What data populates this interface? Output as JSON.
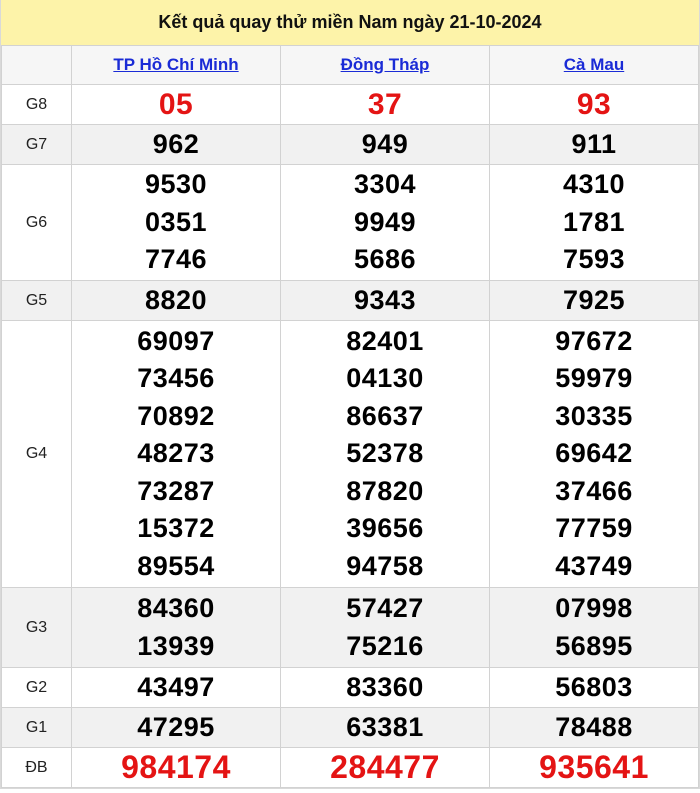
{
  "title": "Kết quả quay thử miền Nam ngày 21-10-2024",
  "provinces": [
    "TP Hồ Chí Minh",
    "Đồng Tháp",
    "Cà Mau"
  ],
  "prizes": [
    {
      "label": "G8",
      "results": [
        [
          "05"
        ],
        [
          "37"
        ],
        [
          "93"
        ]
      ]
    },
    {
      "label": "G7",
      "results": [
        [
          "962"
        ],
        [
          "949"
        ],
        [
          "911"
        ]
      ]
    },
    {
      "label": "G6",
      "results": [
        [
          "9530",
          "0351",
          "7746"
        ],
        [
          "3304",
          "9949",
          "5686"
        ],
        [
          "4310",
          "1781",
          "7593"
        ]
      ]
    },
    {
      "label": "G5",
      "results": [
        [
          "8820"
        ],
        [
          "9343"
        ],
        [
          "7925"
        ]
      ]
    },
    {
      "label": "G4",
      "results": [
        [
          "69097",
          "73456",
          "70892",
          "48273",
          "73287",
          "15372",
          "89554"
        ],
        [
          "82401",
          "04130",
          "86637",
          "52378",
          "87820",
          "39656",
          "94758"
        ],
        [
          "97672",
          "59979",
          "30335",
          "69642",
          "37466",
          "77759",
          "43749"
        ]
      ]
    },
    {
      "label": "G3",
      "results": [
        [
          "84360",
          "13939"
        ],
        [
          "57427",
          "75216"
        ],
        [
          "07998",
          "56895"
        ]
      ]
    },
    {
      "label": "G2",
      "results": [
        [
          "43497"
        ],
        [
          "83360"
        ],
        [
          "56803"
        ]
      ]
    },
    {
      "label": "G1",
      "results": [
        [
          "47295"
        ],
        [
          "63381"
        ],
        [
          "78488"
        ]
      ]
    },
    {
      "label": "ĐB",
      "results": [
        [
          "984174"
        ],
        [
          "284477"
        ],
        [
          "935641"
        ]
      ]
    }
  ],
  "colors": {
    "header_bg": "#fdf3a9",
    "link": "#1a2bd6",
    "red": "#e41414",
    "alt_row": "#f1f1f1"
  }
}
